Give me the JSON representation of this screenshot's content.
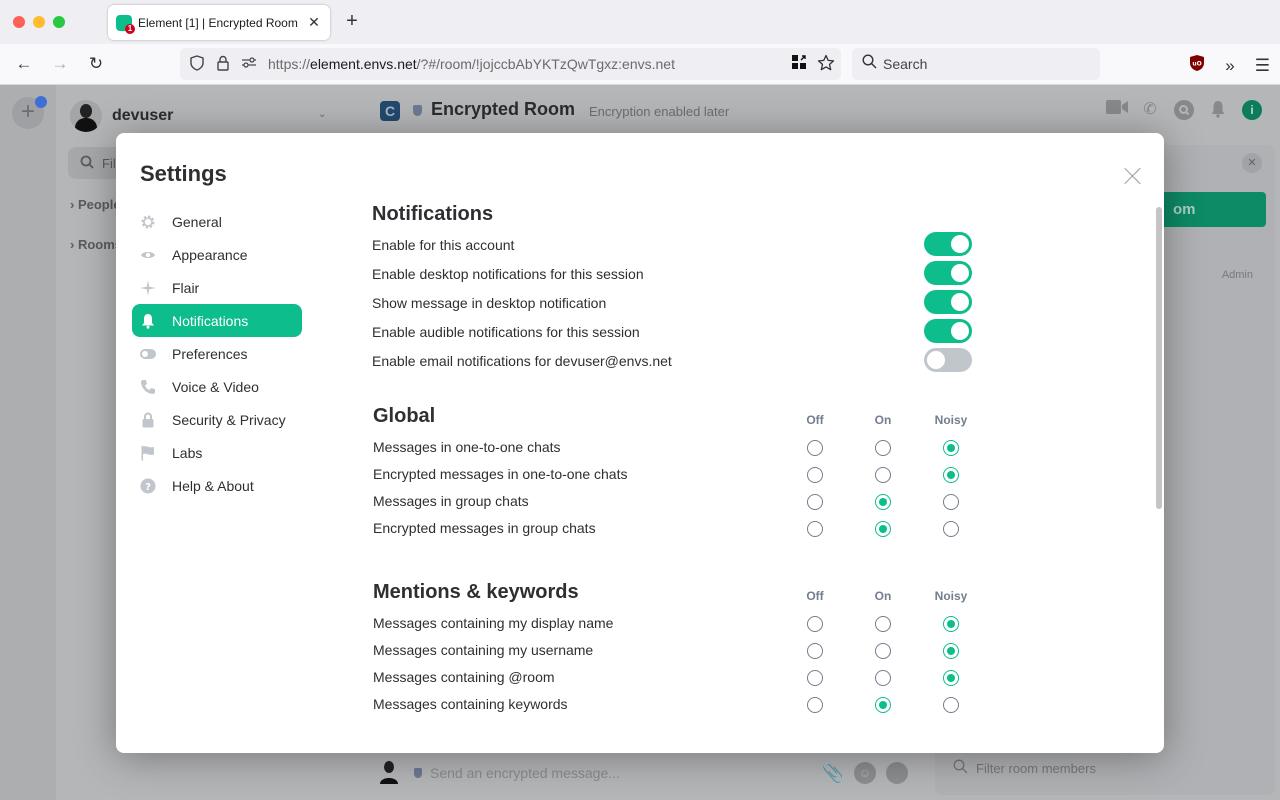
{
  "browser": {
    "tab": {
      "title": "Element [1] | Encrypted Room",
      "favicon": "element-favicon-icon",
      "badge": "1"
    },
    "url": {
      "prefix": "https://",
      "domain": "element.envs.net",
      "path": "/?#/room/!jojccbAbYKTzQwTgxz:envs.net"
    },
    "search_placeholder": "Search"
  },
  "app": {
    "user": {
      "display_name": "devuser"
    },
    "left_panel": {
      "filter_placeholder": "Filter",
      "sections": [
        "People",
        "Rooms"
      ]
    },
    "room": {
      "name": "Encrypted Room",
      "topic": "Encryption enabled later"
    },
    "right_panel": {
      "button_label_partial": "om",
      "role_label": "Admin",
      "filter_placeholder": "Filter room members"
    },
    "composer": {
      "placeholder": "Send an encrypted message..."
    }
  },
  "settings": {
    "title": "Settings",
    "nav": [
      {
        "label": "General",
        "icon": "gear-icon",
        "glyph": "⚙",
        "active": false
      },
      {
        "label": "Appearance",
        "icon": "eye-icon",
        "glyph": "◉",
        "active": false
      },
      {
        "label": "Flair",
        "icon": "sparkle-icon",
        "glyph": "✦",
        "active": false
      },
      {
        "label": "Notifications",
        "icon": "bell-icon",
        "glyph": "🔔",
        "active": true
      },
      {
        "label": "Preferences",
        "icon": "toggle-icon",
        "glyph": "⬬",
        "active": false
      },
      {
        "label": "Voice & Video",
        "icon": "phone-icon",
        "glyph": "✆",
        "active": false
      },
      {
        "label": "Security & Privacy",
        "icon": "lock-icon",
        "glyph": "🔒",
        "active": false
      },
      {
        "label": "Labs",
        "icon": "flag-icon",
        "glyph": "⚑",
        "active": false
      },
      {
        "label": "Help & About",
        "icon": "help-icon",
        "glyph": "?",
        "active": false
      }
    ],
    "notifications": {
      "title": "Notifications",
      "toggles": [
        {
          "label": "Enable for this account",
          "on": true
        },
        {
          "label": "Enable desktop notifications for this session",
          "on": true
        },
        {
          "label": "Show message in desktop notification",
          "on": true
        },
        {
          "label": "Enable audible notifications for this session",
          "on": true
        },
        {
          "label": "Enable email notifications for devuser@envs.net",
          "on": false
        }
      ]
    },
    "columns": {
      "off": "Off",
      "on": "On",
      "noisy": "Noisy"
    },
    "global": {
      "title": "Global",
      "rows": [
        {
          "label": "Messages in one-to-one chats",
          "value": "noisy"
        },
        {
          "label": "Encrypted messages in one-to-one chats",
          "value": "noisy"
        },
        {
          "label": "Messages in group chats",
          "value": "on"
        },
        {
          "label": "Encrypted messages in group chats",
          "value": "on"
        }
      ]
    },
    "mentions": {
      "title": "Mentions & keywords",
      "rows": [
        {
          "label": "Messages containing my display name",
          "value": "noisy"
        },
        {
          "label": "Messages containing my username",
          "value": "noisy"
        },
        {
          "label": "Messages containing @room",
          "value": "noisy"
        },
        {
          "label": "Messages containing keywords",
          "value": "on"
        }
      ]
    }
  },
  "colors": {
    "accent": "#0dbd8b",
    "toggle_off": "#c1c6cd",
    "text": "#2e2f32",
    "muted": "#737d8c"
  }
}
